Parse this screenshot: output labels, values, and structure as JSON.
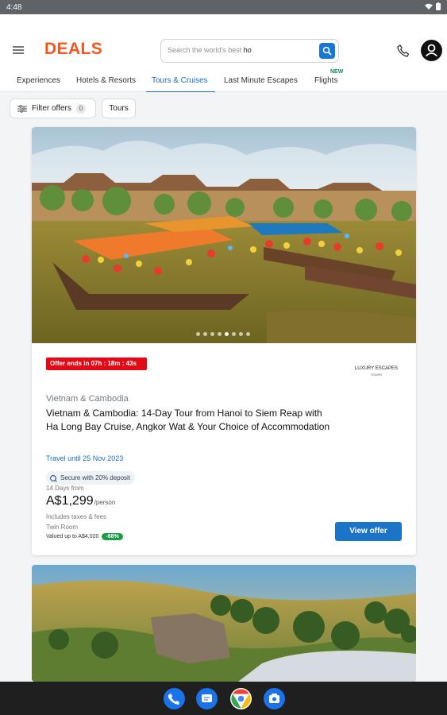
{
  "status": {
    "time": "4:48"
  },
  "brand": {
    "logo": "DEALS"
  },
  "search": {
    "placeholder": "Search the world's best ",
    "typed": "ho"
  },
  "tabs": [
    {
      "label": "Experiences",
      "active": false
    },
    {
      "label": "Hotels & Resorts",
      "active": false
    },
    {
      "label": "Tours & Cruises",
      "active": true
    },
    {
      "label": "Last Minute Escapes",
      "active": false
    },
    {
      "label": "Flights",
      "active": false,
      "badge": "NEW"
    }
  ],
  "filters": {
    "filter_label": "Filter offers",
    "filter_count": "0",
    "category_label": "Tours"
  },
  "offer": {
    "timer": "Offer ends in  07h : 18m : 43s",
    "partner": "LUXURY ESCAPES",
    "partner_sub": "TOURS",
    "location": "Vietnam & Cambodia",
    "title": "Vietnam & Cambodia: 14-Day Tour from Hanoi to Siem Reap with Ha Long Bay Cruise, Angkor Wat & Your Choice of Accommodation",
    "travel_until": "Travel until 25 Nov 2023",
    "deposit": "Secure with 20% deposit",
    "days": "14 Days from",
    "price": "A$1,299",
    "price_unit": "/person",
    "taxes": "Includes taxes & fees",
    "room": "Twin Room",
    "valued": "Valued up to A$4,020",
    "discount": "-68%",
    "cta": "View offer",
    "carousel_count": 8,
    "carousel_active": 5
  },
  "colors": {
    "brand": "#f1571f",
    "link": "#1b6cc1",
    "timer": "#e00b17",
    "discount": "#1a9e45"
  },
  "icons": [
    "menu-icon",
    "search-icon",
    "phone-icon",
    "account-icon",
    "filter-icon",
    "deposit-icon",
    "nav-phone-icon",
    "nav-messages-icon",
    "nav-chrome-icon",
    "nav-camera-icon"
  ]
}
